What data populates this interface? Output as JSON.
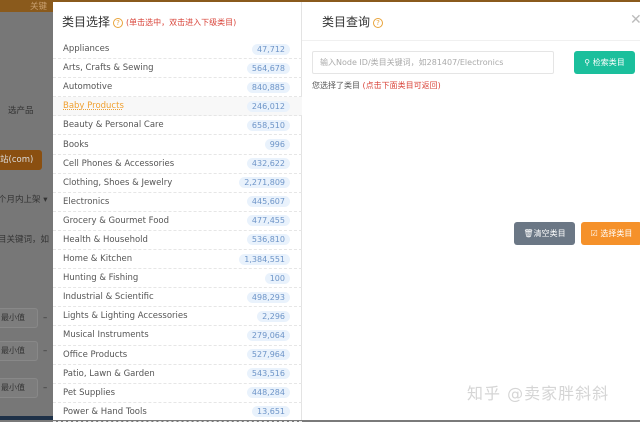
{
  "background": {
    "top_text": "关键",
    "label_select": "选产品",
    "site_button": "站(com)",
    "month_select": "个月内上架 ▾",
    "keyword": "目关键词，如",
    "min_placeholder": "最小值",
    "dash": "–"
  },
  "left_panel": {
    "title": "类目选择",
    "help": "?",
    "hint": "(单击选中，双击进入下级类目)",
    "items": [
      {
        "name": "Appliances",
        "count": "47,712"
      },
      {
        "name": "Arts, Crafts & Sewing",
        "count": "564,678"
      },
      {
        "name": "Automotive",
        "count": "840,885"
      },
      {
        "name": "Baby Products",
        "count": "246,012",
        "selected": true
      },
      {
        "name": "Beauty & Personal Care",
        "count": "658,510"
      },
      {
        "name": "Books",
        "count": "996"
      },
      {
        "name": "Cell Phones & Accessories",
        "count": "432,622"
      },
      {
        "name": "Clothing, Shoes & Jewelry",
        "count": "2,271,809"
      },
      {
        "name": "Electronics",
        "count": "445,607"
      },
      {
        "name": "Grocery & Gourmet Food",
        "count": "477,455"
      },
      {
        "name": "Health & Household",
        "count": "536,810"
      },
      {
        "name": "Home & Kitchen",
        "count": "1,384,551"
      },
      {
        "name": "Hunting & Fishing",
        "count": "100"
      },
      {
        "name": "Industrial & Scientific",
        "count": "498,293"
      },
      {
        "name": "Lights & Lighting Accessories",
        "count": "2,296"
      },
      {
        "name": "Musical Instruments",
        "count": "279,064"
      },
      {
        "name": "Office Products",
        "count": "527,964"
      },
      {
        "name": "Patio, Lawn & Garden",
        "count": "543,516"
      },
      {
        "name": "Pet Supplies",
        "count": "448,284"
      },
      {
        "name": "Power & Hand Tools",
        "count": "13,651"
      }
    ]
  },
  "right_panel": {
    "title": "类目查询",
    "help": "?",
    "close": "✕",
    "search_placeholder": "输入Node ID/类目关键词，如281407/Electronics",
    "search_button": "检索类目",
    "chosen_label": "您选择了类目",
    "chosen_hint": "(点击下面类目可返回)",
    "clear_button": "清空类目",
    "select_button": "选择类目"
  },
  "watermark": "知乎 @卖家胖斜斜"
}
